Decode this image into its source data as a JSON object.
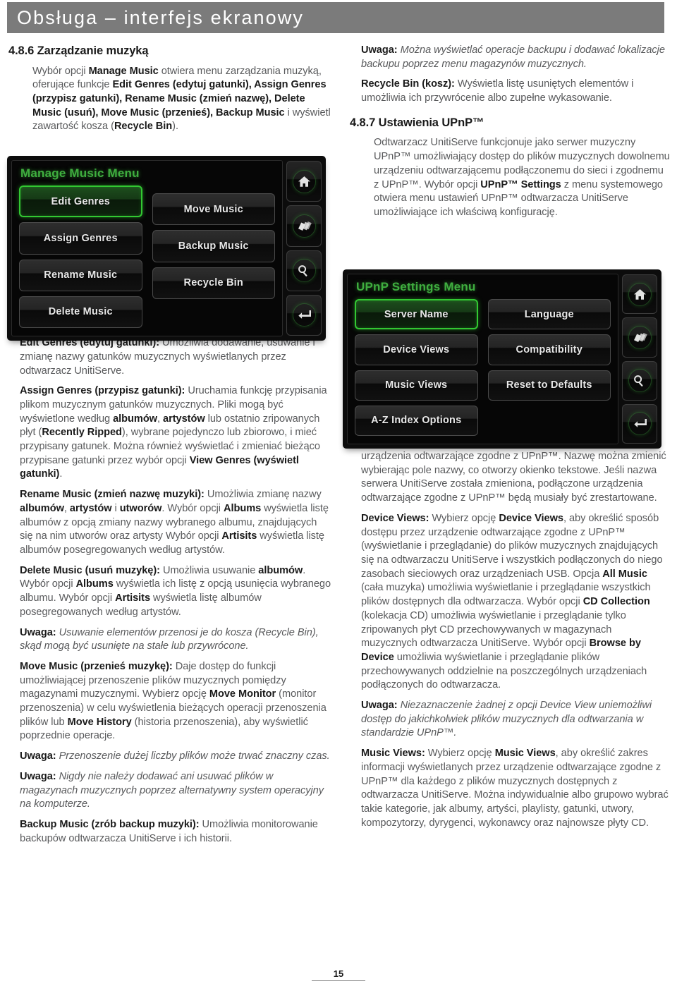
{
  "header": {
    "title": "Obsługa – interfejs ekranowy"
  },
  "left_column": {
    "section_number_title": "4.8.6 Zarządzanie muzyką",
    "intro_html": "Wybór opcji <b>Manage Music</b> otwiera menu zarządzania muzyką, oferujące funkcje <b>Edit Genres (edytuj gatunki), Assign Genres (przypisz gatunki), Rename Music (zmień nazwę), Delete Music (usuń), Move Music (przenieś), Backup Music</b> i wyświetl zawartość kosza (<b>Recycle Bin</b>).",
    "paragraphs": [
      {
        "id": "edit-genres",
        "html": "<b>Edit Genres (edytuj gatunki):</b> Umożliwia dodawanie, usuwanie i zmianę nazwy gatunków muzycznych wyświetlanych przez odtwarzacz UnitiServe."
      },
      {
        "id": "assign-genres",
        "html": "<b>Assign Genres (przypisz gatunki):</b> Uruchamia funkcję przypisania plikom muzycznym gatunków muzycznych. Pliki mogą być wyświetlone według <b>albumów</b>, <b>artystów</b> lub ostatnio zripowanych płyt (<b>Recently Ripped</b>), wybrane pojedynczo lub zbiorowo, i mieć przypisany gatunek. Można również wyświetlać i zmieniać bieżąco przypisane gatunki przez wybór opcji <b>View Genres (wyświetl gatunki)</b>."
      },
      {
        "id": "rename-music",
        "html": "<b>Rename Music (zmień nazwę muzyki):</b> Umożliwia zmianę nazwy <b>albumów</b>, <b>artystów</b> i <b>utworów</b>. Wybór opcji <b>Albums</b> wyświetla listę albumów z opcją zmiany nazwy wybranego albumu, znajdujących się na nim utworów oraz artysty Wybór opcji <b>Artisits</b> wyświetla listę albumów posegregowanych według artystów."
      },
      {
        "id": "delete-music",
        "html": "<b>Delete Music (usuń muzykę):</b> Umożliwia usuwanie <b>albumów</b>. Wybór opcji <b>Albums</b> wyświetla ich listę z opcją usunięcia wybranego albumu. Wybór opcji <b>Artisits</b> wyświetla listę albumów posegregowanych według artystów."
      },
      {
        "id": "note-recycle",
        "html": "<b>Uwaga:</b> <i>Usuwanie elementów przenosi je do kosza (Recycle Bin), skąd mogą być usunięte na stałe lub przywrócone.</i>"
      },
      {
        "id": "move-music",
        "html": "<b>Move Music (przenieś muzykę):</b> Daje dostęp do funkcji umożliwiającej przenoszenie plików muzycznych pomiędzy magazynami muzycznymi. Wybierz opcję <b>Move Monitor</b> (monitor przenoszenia) w celu wyświetlenia bieżących operacji przenoszenia plików lub <b>Move History</b> (historia przenoszenia), aby wyświetlić poprzednie operacje."
      },
      {
        "id": "note-move-time",
        "html": "<b>Uwaga:</b> <i>Przenoszenie dużej liczby plików może trwać znaczny czas.</i>"
      },
      {
        "id": "note-never-add",
        "html": "<b>Uwaga:</b> <i>Nigdy nie należy dodawać ani usuwać plików w magazynach muzycznych poprzez alternatywny system operacyjny na komputerze.</i>"
      },
      {
        "id": "backup-music",
        "html": "<b>Backup Music (zrób backup muzyki):</b> Umożliwia monitorowanie backupów odtwarzacza UnitiServe i ich historii."
      }
    ]
  },
  "right_column": {
    "paragraphs_top": [
      {
        "id": "note-backup",
        "html": "<b>Uwaga:</b> <i>Można wyświetlać operacje backupu i dodawać lokalizacje backupu poprzez menu magazynów muzycznych.</i>"
      },
      {
        "id": "recycle-bin",
        "html": "<b>Recycle Bin (kosz):</b> Wyświetla listę usuniętych elementów i umożliwia ich przywrócenie albo zupełne wykasowanie."
      }
    ],
    "section_number_title": "4.8.7 Ustawienia UPnP™",
    "intro_html": "Odtwarzacz UnitiServe funkcjonuje jako serwer muzyczny UPnP™ umożliwiający dostęp do plików muzycznych dowolnemu urządzeniu odtwarzającemu podłączonemu do sieci i zgodnemu z UPnP™. Wybór opcji <b>UPnP™ Settings</b> z menu systemowego otwiera menu ustawień UPnP™ odtwarzacza UnitiServe umożliwiające ich właściwą konfigurację.",
    "paragraphs_bottom": [
      {
        "id": "server-name",
        "html": "<b>Server Name:</b> Wybierz opcję <b>Server Name</b>, aby określić nazwę serwera UPnP™ odtwarzacza UnitiServe, widzianą przez urządzenia odtwarzające zgodne z UPnP™. Nazwę można zmienić wybierając pole nazwy, co otworzy okienko tekstowe. Jeśli nazwa serwera UnitiServe została zmieniona, podłączone urządzenia odtwarzające zgodne z UPnP™ będą musiały być zrestartowane."
      },
      {
        "id": "device-views",
        "html": "<b>Device Views:</b> Wybierz opcję <b>Device Views</b>, aby określić sposób dostępu przez urządzenie odtwarzające zgodne z UPnP™ (wyświetlanie i przeglądanie) do plików muzycznych znajdujących się na odtwarzaczu UnitiServe i wszystkich podłączonych do niego zasobach sieciowych oraz urządzeniach USB. Opcja <b>All Music</b> (cała muzyka) umożliwia wyświetlanie i przeglądanie wszystkich plików dostępnych dla odtwarzacza. Wybór opcji <b>CD Collection</b> (kolekacja CD) umożliwia wyświetlanie i przeglądanie tylko zripowanych płyt CD przechowywanych w magazynach muzycznych odtwarzacza UnitiServe. Wybór opcji <b>Browse by Device</b> umożliwia wyświetlanie i przeglądanie plików przechowywanych oddzielnie na poszczególnych urządzeniach podłączonych do odtwarzacza."
      },
      {
        "id": "note-device-view",
        "html": "<b>Uwaga:</b> <i>Niezaznaczenie żadnej z opcji Device View uniemożliwi dostęp do jakichkolwiek plików muzycznych dla odtwarzania w standardzie UPnP™.</i>"
      },
      {
        "id": "music-views",
        "html": "<b>Music Views:</b> Wybierz opcję <b>Music Views</b>, aby określić zakres informacji wyświetlanych przez urządzenie odtwarzające zgodne z UPnP™ dla każdego z plików muzycznych dostępnych z odtwarzacza UnitiServe. Można indywidualnie albo grupowo wybrać takie kategorie, jak albumy, artyści, playlisty, gatunki, utwory, kompozytorzy, dyrygenci, wykonawcy oraz najnowsze płyty CD."
      }
    ]
  },
  "screenshot_manage_music": {
    "screen_title": "Manage Music Menu",
    "buttons_left": [
      {
        "label": "Edit Genres",
        "selected": true
      },
      {
        "label": "Assign Genres",
        "selected": false
      },
      {
        "label": "Rename Music",
        "selected": false
      },
      {
        "label": "Delete Music",
        "selected": false
      }
    ],
    "buttons_right": [
      {
        "label": "Move Music",
        "selected": false
      },
      {
        "label": "Backup Music",
        "selected": false
      },
      {
        "label": "Recycle Bin",
        "selected": false
      },
      {
        "label": "",
        "selected": false
      }
    ],
    "side_icons": [
      "home-icon",
      "cards-icon",
      "search-icon",
      "enter-icon"
    ]
  },
  "screenshot_upnp_settings": {
    "screen_title": "UPnP Settings Menu",
    "buttons_left": [
      {
        "label": "Server Name",
        "selected": true
      },
      {
        "label": "Device Views",
        "selected": false
      },
      {
        "label": "Music Views",
        "selected": false
      },
      {
        "label": "A-Z Index Options",
        "selected": false
      }
    ],
    "buttons_right": [
      {
        "label": "Language",
        "selected": false
      },
      {
        "label": "Compatibility",
        "selected": false
      },
      {
        "label": "Reset to Defaults",
        "selected": false
      },
      {
        "label": "",
        "selected": false
      }
    ],
    "side_icons": [
      "home-icon",
      "cards-icon",
      "search-icon",
      "enter-icon"
    ]
  },
  "footer": {
    "page_number": "15"
  },
  "colors": {
    "header_band": "#7b7b7b",
    "screen_accent_green": "#3fae3f",
    "body_text": "#58595b",
    "bold_text": "#1a1a1a"
  }
}
